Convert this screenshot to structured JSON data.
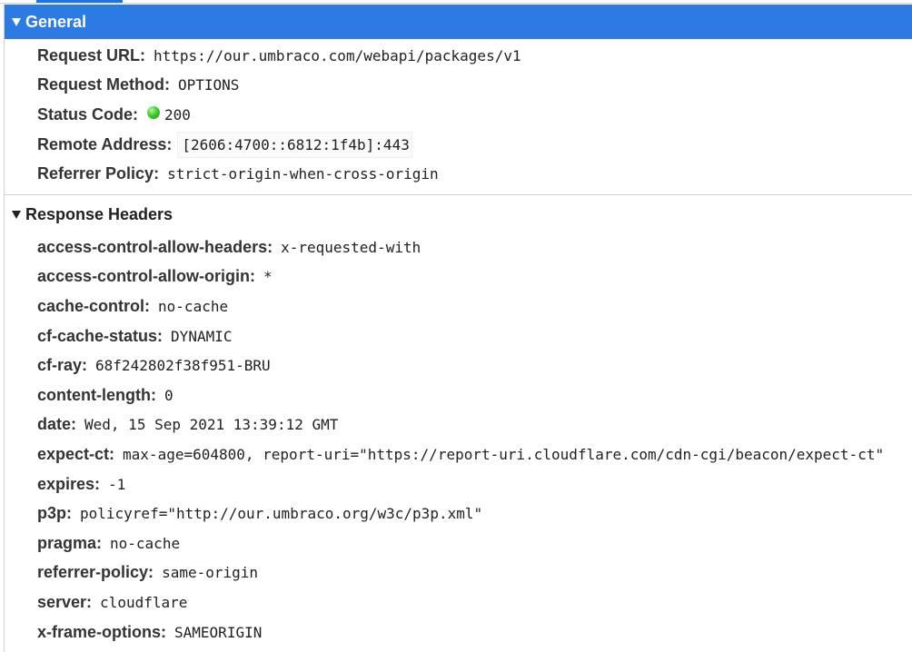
{
  "general": {
    "title": "General",
    "rows": [
      {
        "key": "Request URL:",
        "value": "https://our.umbraco.com/webapi/packages/v1"
      },
      {
        "key": "Request Method:",
        "value": "OPTIONS"
      },
      {
        "key": "Status Code:",
        "value": "200",
        "status_color": "#3fcf2a"
      },
      {
        "key": "Remote Address:",
        "value": "[2606:4700::6812:1f4b]:443"
      },
      {
        "key": "Referrer Policy:",
        "value": "strict-origin-when-cross-origin"
      }
    ]
  },
  "response": {
    "title": "Response Headers",
    "rows": [
      {
        "key": "access-control-allow-headers:",
        "value": "x-requested-with"
      },
      {
        "key": "access-control-allow-origin:",
        "value": "*"
      },
      {
        "key": "cache-control:",
        "value": "no-cache"
      },
      {
        "key": "cf-cache-status:",
        "value": "DYNAMIC"
      },
      {
        "key": "cf-ray:",
        "value": "68f242802f38f951-BRU"
      },
      {
        "key": "content-length:",
        "value": "0"
      },
      {
        "key": "date:",
        "value": "Wed, 15 Sep 2021 13:39:12 GMT"
      },
      {
        "key": "expect-ct:",
        "value": "max-age=604800, report-uri=\"https://report-uri.cloudflare.com/cdn-cgi/beacon/expect-ct\""
      },
      {
        "key": "expires:",
        "value": "-1"
      },
      {
        "key": "p3p:",
        "value": "policyref=\"http://our.umbraco.org/w3c/p3p.xml\""
      },
      {
        "key": "pragma:",
        "value": "no-cache"
      },
      {
        "key": "referrer-policy:",
        "value": "same-origin"
      },
      {
        "key": "server:",
        "value": "cloudflare"
      },
      {
        "key": "x-frame-options:",
        "value": "SAMEORIGIN"
      }
    ]
  },
  "colors": {
    "selected_header": "#2c7be5",
    "accent": "#1a73e8"
  },
  "icons": {
    "expand": "triangle-down-icon",
    "status": "green-dot-icon"
  }
}
